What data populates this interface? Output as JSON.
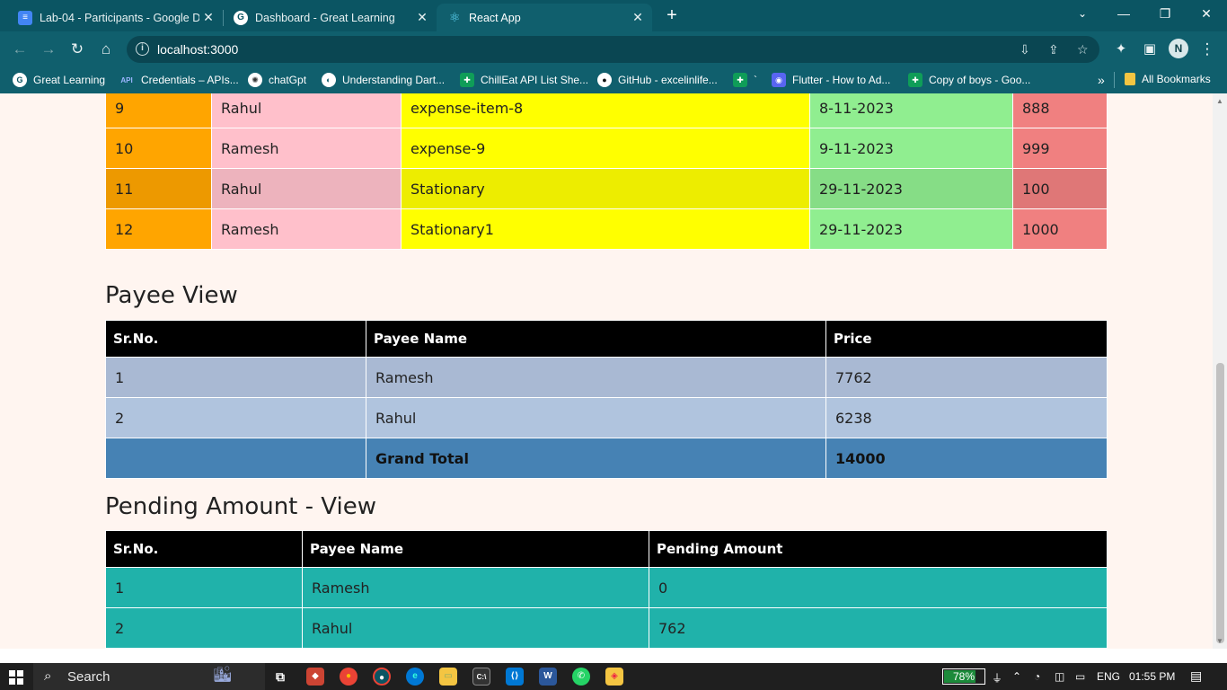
{
  "tabs": [
    {
      "title": "Lab-04 - Participants - Google D",
      "icon": "google-docs-icon",
      "color": "#4285f4"
    },
    {
      "title": "Dashboard - Great Learning",
      "icon": "great-learning-icon",
      "color": "#ffffff"
    },
    {
      "title": "React App",
      "icon": "react-icon",
      "color": "#61dafb"
    }
  ],
  "window": {
    "minimize": "—",
    "maximize": "❐",
    "close": "✕"
  },
  "address_bar": {
    "url": "localhost:3000"
  },
  "profile": {
    "initial": "N"
  },
  "bookmarks": [
    {
      "label": "Great Learning",
      "icon": "great-learning-icon"
    },
    {
      "label": "Credentials – APIs...",
      "icon": "api-icon"
    },
    {
      "label": "chatGpt",
      "icon": "openai-icon"
    },
    {
      "label": "Understanding Dart...",
      "icon": "globe-icon"
    },
    {
      "label": "ChillEat API List She...",
      "icon": "sheets-icon"
    },
    {
      "label": "GitHub - excelinlife...",
      "icon": "github-icon"
    },
    {
      "label": "`",
      "icon": "sheets-icon"
    },
    {
      "label": "Flutter - How to Ad...",
      "icon": "discord-icon"
    },
    {
      "label": "Copy of boys - Goo...",
      "icon": "sheets-icon"
    }
  ],
  "all_bookmarks": "All Bookmarks",
  "expenses": {
    "rows": [
      {
        "id": "9",
        "payee": "Rahul",
        "item": "expense-item-8",
        "date": "8-11-2023",
        "price": "888"
      },
      {
        "id": "10",
        "payee": "Ramesh",
        "item": "expense-9",
        "date": "9-11-2023",
        "price": "999"
      },
      {
        "id": "11",
        "payee": "Rahul",
        "item": "Stationary",
        "date": "29-11-2023",
        "price": "100"
      },
      {
        "id": "12",
        "payee": "Ramesh",
        "item": "Stationary1",
        "date": "29-11-2023",
        "price": "1000"
      }
    ]
  },
  "payee_view": {
    "title": "Payee View",
    "headers": [
      "Sr.No.",
      "Payee Name",
      "Price"
    ],
    "rows": [
      {
        "sr": "1",
        "name": "Ramesh",
        "price": "7762"
      },
      {
        "sr": "2",
        "name": "Rahul",
        "price": "6238"
      }
    ],
    "total_label": "Grand Total",
    "total_value": "14000"
  },
  "pending_view": {
    "title": "Pending Amount - View",
    "headers": [
      "Sr.No.",
      "Payee Name",
      "Pending Amount"
    ],
    "rows": [
      {
        "sr": "1",
        "name": "Ramesh",
        "amount": "0"
      },
      {
        "sr": "2",
        "name": "Rahul",
        "amount": "762"
      }
    ]
  },
  "taskbar": {
    "search": "Search",
    "battery": "78%",
    "language": "ENG",
    "time": "01:55 PM"
  },
  "colors": {
    "chrome": "#105f6d",
    "tabstrip": "#0b5563",
    "page_bg": "#fff5f0",
    "orange": "#ffa500",
    "pink": "#ffc0cb",
    "yellow": "#ffff00",
    "lightgreen": "#90ee90",
    "lightcoral": "#f08080",
    "steelblue": "#4682b4",
    "lightsteelblue": "#b0c4de",
    "lightseagreen": "#20b2aa"
  }
}
